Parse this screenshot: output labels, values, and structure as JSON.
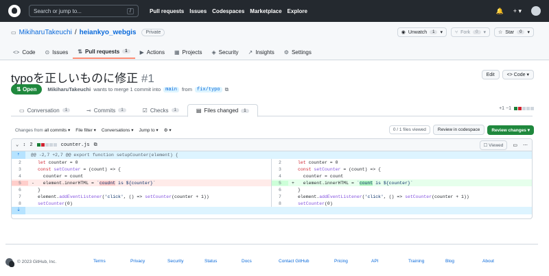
{
  "header": {
    "search": "Search or jump to...",
    "slash": "/",
    "nav": [
      "Pull requests",
      "Issues",
      "Codespaces",
      "Marketplace",
      "Explore"
    ],
    "bell": "🔔",
    "plus": "+ ▾"
  },
  "repo": {
    "owner": "MikiharuTakeuchi",
    "sep": "/",
    "name": "heiankyo_webgis",
    "visibility": "Private",
    "unwatch": "Unwatch",
    "unwatch_count": "1",
    "fork": "Fork",
    "fork_count": "0",
    "star": "Star",
    "star_count": "0",
    "tabs": [
      {
        "icon": "<>",
        "label": "Code"
      },
      {
        "icon": "⊙",
        "label": "Issues"
      },
      {
        "icon": "⇅",
        "label": "Pull requests",
        "count": "1"
      },
      {
        "icon": "▶",
        "label": "Actions"
      },
      {
        "icon": "▦",
        "label": "Projects"
      },
      {
        "icon": "◈",
        "label": "Security"
      },
      {
        "icon": "↗",
        "label": "Insights"
      },
      {
        "icon": "⚙",
        "label": "Settings"
      }
    ]
  },
  "pr": {
    "title": "typoを正しいものに修正",
    "number": "#1",
    "edit": "Edit",
    "code": "Code",
    "state": "Open",
    "author": "MikiharuTakeuchi",
    "merge_text": "wants to merge 1 commit into",
    "base": "main",
    "from": "from",
    "head": "fix/typo",
    "tabs": [
      {
        "label": "Conversation",
        "count": "1"
      },
      {
        "label": "Commits",
        "count": "1"
      },
      {
        "label": "Checks",
        "count": "1"
      },
      {
        "label": "Files changed",
        "count": "1"
      }
    ],
    "diffstat": "+1 −1"
  },
  "toolbar": {
    "changes_from": "Changes from",
    "all_commits": "all commits ▾",
    "file_filter": "File filter ▾",
    "conversations": "Conversations ▾",
    "jump_to": "Jump to ▾",
    "settings": "⚙ ▾",
    "files_viewed": "0 / 1 files viewed",
    "review_codespace": "Review in codespace",
    "review_changes": "Review changes ▾"
  },
  "file": {
    "changes": "2",
    "name": "counter.js",
    "viewed": "Viewed",
    "hunk": "@@ -2,7 +2,7 @@ export function setupCounter(element) {",
    "left": [
      {
        "n": "2",
        "s": " ",
        "t": "let counter = 0",
        "k": "ctx"
      },
      {
        "n": "3",
        "s": " ",
        "t": "const setCounter = (count) => {",
        "k": "ctx"
      },
      {
        "n": "4",
        "s": " ",
        "t": "  counter = count",
        "k": "ctx"
      },
      {
        "n": "5",
        "s": "-",
        "t": "  element.innerHTML = `coudnt is ${counter}`",
        "k": "del"
      },
      {
        "n": "6",
        "s": " ",
        "t": "}",
        "k": "ctx"
      },
      {
        "n": "7",
        "s": " ",
        "t": "element.addEventListener('click', () => setCounter(counter + 1))",
        "k": "ctx"
      },
      {
        "n": "8",
        "s": " ",
        "t": "setCounter(0)",
        "k": "ctx"
      }
    ],
    "right": [
      {
        "n": "2",
        "s": " ",
        "t": "let counter = 0",
        "k": "ctx"
      },
      {
        "n": "3",
        "s": " ",
        "t": "const setCounter = (count) => {",
        "k": "ctx"
      },
      {
        "n": "4",
        "s": " ",
        "t": "  counter = count",
        "k": "ctx"
      },
      {
        "n": "5",
        "s": "+",
        "t": "  element.innerHTML = `count is ${counter}`",
        "k": "add"
      },
      {
        "n": "6",
        "s": " ",
        "t": "}",
        "k": "ctx"
      },
      {
        "n": "7",
        "s": " ",
        "t": "element.addEventListener('click', () => setCounter(counter + 1))",
        "k": "ctx"
      },
      {
        "n": "8",
        "s": " ",
        "t": "setCounter(0)",
        "k": "ctx"
      }
    ]
  },
  "footer": {
    "copy": "© 2023 GitHub, Inc.",
    "links": [
      "Terms",
      "Privacy",
      "Security",
      "Status",
      "Docs",
      "Contact GitHub",
      "Pricing",
      "API",
      "Training",
      "Blog",
      "About"
    ]
  },
  "colors": {
    "open": "#1f883d",
    "link": "#0969da",
    "header": "#24292f"
  }
}
